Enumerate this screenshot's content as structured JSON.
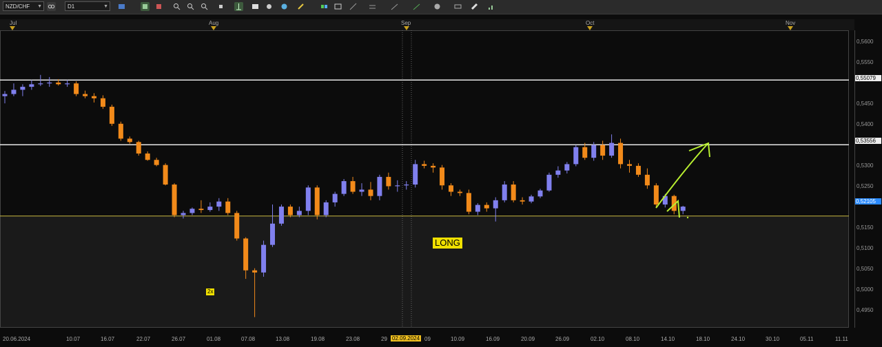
{
  "toolbar": {
    "symbol": "NZD/CHF",
    "timeframe": "D1",
    "colors": {
      "bg": "#2b2b2b"
    }
  },
  "timeline": {
    "months": [
      "Jul",
      "Aug",
      "Sep",
      "Oct",
      "Nov"
    ]
  },
  "y_axis": {
    "labels": [
      "0,5600",
      "0,5550",
      "0,5450",
      "0,5400",
      "0,5300",
      "0,5250",
      "0,5150",
      "0,5100",
      "0,5050",
      "0,5000",
      "0,4950"
    ],
    "levels": [
      {
        "label": "0,55079",
        "value": 0.55079,
        "color": "#e8e8e8"
      },
      {
        "label": "0,53556",
        "value": 0.53556,
        "color": "#e8e8e8"
      },
      {
        "label": "0,52105",
        "value": 0.52105,
        "color": "#2a8aff"
      }
    ],
    "support_value": 0.5188,
    "range": [
      0.4925,
      0.5625
    ]
  },
  "x_axis": {
    "labels": [
      "20.06.2024",
      "10.07",
      "16.07",
      "22.07",
      "26.07",
      "01.08",
      "07.08",
      "13.08",
      "19.08",
      "23.08",
      "29",
      "02.09.2024",
      "09",
      "10.09",
      "16.09",
      "20.09",
      "26.09",
      "02.10",
      "08.10",
      "14.10",
      "18.10",
      "24.10",
      "30.10",
      "05.11",
      "11.11"
    ],
    "highlight": "02.09.2024"
  },
  "annotations": {
    "long_label": "LONG",
    "count_badge": "2x"
  },
  "chart_data": {
    "type": "candlestick",
    "colors": {
      "bull": "#8080ee",
      "bear": "#f28a1a",
      "resistance": "#e8e8e8",
      "support": "#c8b840",
      "arrow": "#b8ee30"
    },
    "candles": [
      [
        0.547,
        0.5482,
        0.5453,
        0.5475
      ],
      [
        0.5475,
        0.55,
        0.547,
        0.5485
      ],
      [
        0.5485,
        0.5498,
        0.547,
        0.5492
      ],
      [
        0.5492,
        0.5508,
        0.5485,
        0.5498
      ],
      [
        0.5498,
        0.552,
        0.5494,
        0.55
      ],
      [
        0.55,
        0.5515,
        0.5492,
        0.5502
      ],
      [
        0.5502,
        0.551,
        0.5495,
        0.5498
      ],
      [
        0.5498,
        0.5508,
        0.5492,
        0.55
      ],
      [
        0.55,
        0.5505,
        0.547,
        0.5475
      ],
      [
        0.5475,
        0.5483,
        0.5465,
        0.547
      ],
      [
        0.547,
        0.5477,
        0.5455,
        0.5465
      ],
      [
        0.5465,
        0.5472,
        0.544,
        0.5445
      ],
      [
        0.5445,
        0.545,
        0.54,
        0.5405
      ],
      [
        0.5405,
        0.541,
        0.5365,
        0.537
      ],
      [
        0.537,
        0.5375,
        0.5358,
        0.5362
      ],
      [
        0.5362,
        0.5365,
        0.533,
        0.5335
      ],
      [
        0.5335,
        0.534,
        0.5318,
        0.532
      ],
      [
        0.532,
        0.5325,
        0.5305,
        0.5308
      ],
      [
        0.5308,
        0.5312,
        0.526,
        0.5262
      ],
      [
        0.5262,
        0.5265,
        0.5185,
        0.519
      ],
      [
        0.519,
        0.52,
        0.5182,
        0.5195
      ],
      [
        0.5195,
        0.5208,
        0.519,
        0.5205
      ],
      [
        0.5205,
        0.5225,
        0.5195,
        0.5202
      ],
      [
        0.5202,
        0.522,
        0.5198,
        0.521
      ],
      [
        0.521,
        0.523,
        0.52,
        0.5222
      ],
      [
        0.5222,
        0.523,
        0.519,
        0.5195
      ],
      [
        0.5195,
        0.52,
        0.513,
        0.5135
      ],
      [
        0.5135,
        0.5138,
        0.504,
        0.506
      ],
      [
        0.506,
        0.5065,
        0.495,
        0.5055
      ],
      [
        0.5055,
        0.513,
        0.5045,
        0.512
      ],
      [
        0.512,
        0.5215,
        0.5115,
        0.517
      ],
      [
        0.517,
        0.5215,
        0.5165,
        0.521
      ],
      [
        0.521,
        0.5215,
        0.5185,
        0.519
      ],
      [
        0.519,
        0.521,
        0.5185,
        0.52
      ],
      [
        0.52,
        0.526,
        0.519,
        0.5255
      ],
      [
        0.5255,
        0.526,
        0.518,
        0.519
      ],
      [
        0.519,
        0.5225,
        0.5185,
        0.522
      ],
      [
        0.522,
        0.5245,
        0.521,
        0.524
      ],
      [
        0.524,
        0.5275,
        0.5235,
        0.527
      ],
      [
        0.527,
        0.528,
        0.524,
        0.5245
      ],
      [
        0.5245,
        0.5265,
        0.5235,
        0.525
      ],
      [
        0.525,
        0.5268,
        0.5225,
        0.5235
      ],
      [
        0.5235,
        0.5285,
        0.5225,
        0.528
      ],
      [
        0.528,
        0.529,
        0.525,
        0.5258
      ],
      [
        0.5258,
        0.5272,
        0.5245,
        0.526
      ],
      [
        0.526,
        0.527,
        0.525,
        0.5262
      ],
      [
        0.5262,
        0.532,
        0.5255,
        0.531
      ],
      [
        0.531,
        0.5318,
        0.53,
        0.5306
      ],
      [
        0.5306,
        0.5312,
        0.529,
        0.5302
      ],
      [
        0.5302,
        0.5308,
        0.525,
        0.526
      ],
      [
        0.526,
        0.5265,
        0.5235,
        0.5245
      ],
      [
        0.5245,
        0.525,
        0.5235,
        0.5242
      ],
      [
        0.5242,
        0.525,
        0.5192,
        0.5198
      ],
      [
        0.5198,
        0.5218,
        0.519,
        0.5214
      ],
      [
        0.5214,
        0.522,
        0.5198,
        0.5206
      ],
      [
        0.5206,
        0.5232,
        0.5175,
        0.5225
      ],
      [
        0.5225,
        0.527,
        0.522,
        0.5262
      ],
      [
        0.5262,
        0.527,
        0.522,
        0.5225
      ],
      [
        0.5225,
        0.5232,
        0.5215,
        0.5222
      ],
      [
        0.5222,
        0.5238,
        0.5218,
        0.5234
      ],
      [
        0.5234,
        0.5252,
        0.523,
        0.5248
      ],
      [
        0.5248,
        0.529,
        0.5245,
        0.5285
      ],
      [
        0.5285,
        0.5305,
        0.5278,
        0.5295
      ],
      [
        0.5295,
        0.5315,
        0.5288,
        0.531
      ],
      [
        0.531,
        0.5355,
        0.5305,
        0.535
      ],
      [
        0.535,
        0.536,
        0.532,
        0.5325
      ],
      [
        0.5325,
        0.5362,
        0.5318,
        0.5355
      ],
      [
        0.5355,
        0.5365,
        0.532,
        0.533
      ],
      [
        0.533,
        0.538,
        0.5325,
        0.536
      ],
      [
        0.536,
        0.537,
        0.53,
        0.531
      ],
      [
        0.531,
        0.532,
        0.529,
        0.5306
      ],
      [
        0.5306,
        0.5312,
        0.528,
        0.5285
      ],
      [
        0.5285,
        0.53,
        0.5252,
        0.526
      ],
      [
        0.526,
        0.5265,
        0.521,
        0.5215
      ],
      [
        0.5215,
        0.524,
        0.5208,
        0.5235
      ],
      [
        0.5235,
        0.5238,
        0.5192,
        0.52
      ],
      [
        0.52,
        0.5212,
        0.5192,
        0.521
      ]
    ],
    "resistance_levels": [
      0.55079,
      0.53556
    ],
    "support_level": 0.5188
  }
}
